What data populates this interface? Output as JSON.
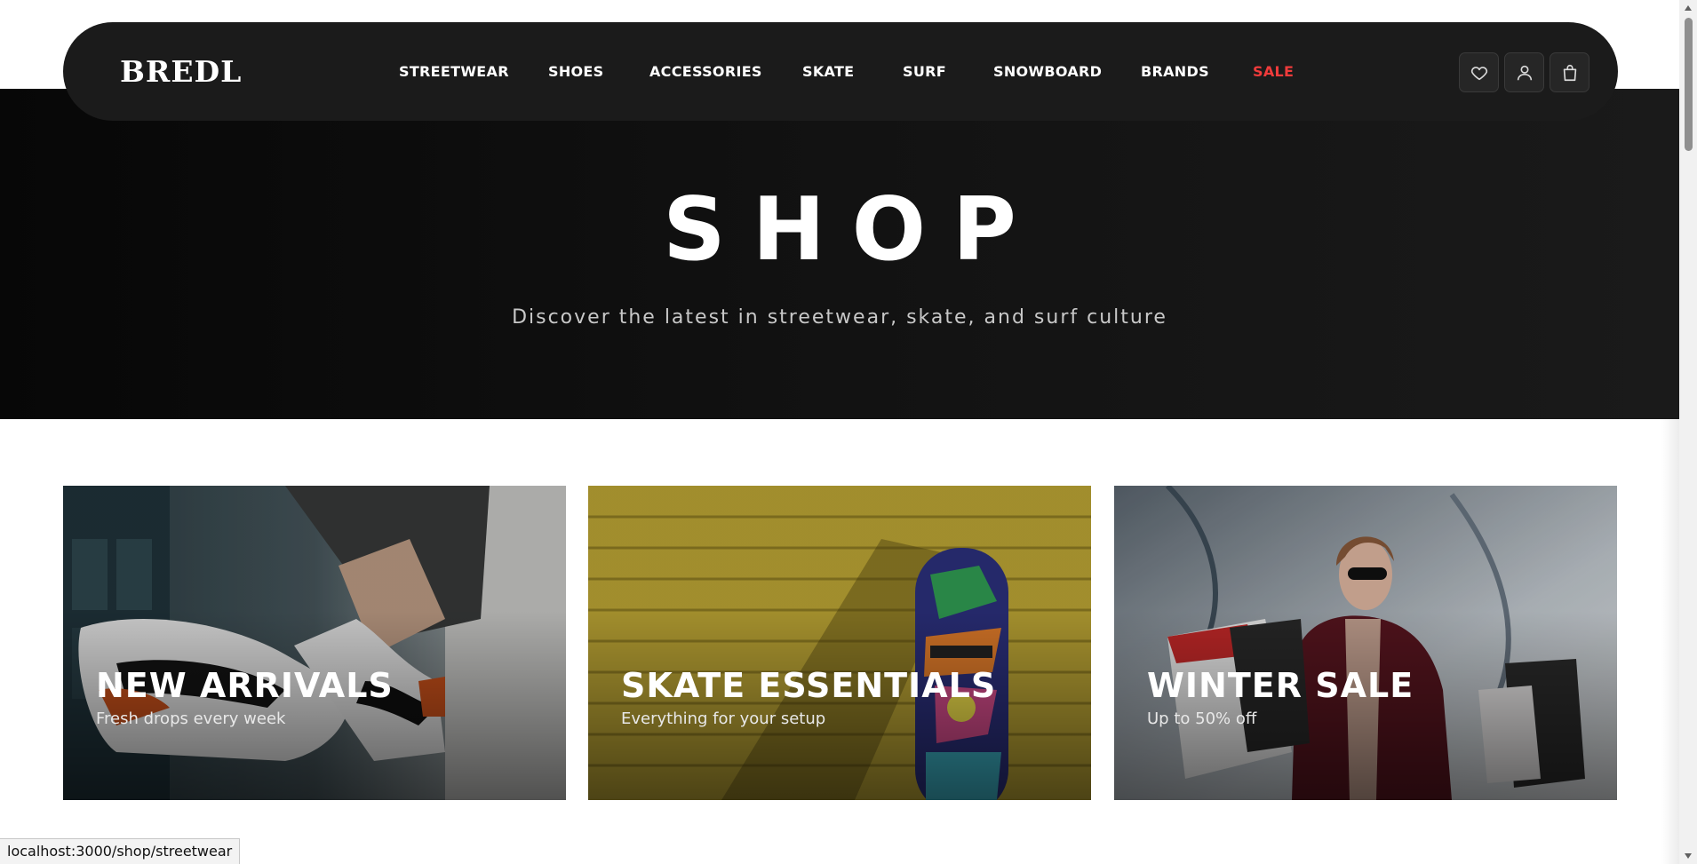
{
  "brand": {
    "logo": "BREDL"
  },
  "nav": {
    "items": [
      {
        "label": "STREETWEAR"
      },
      {
        "label": "SHOES"
      },
      {
        "label": "ACCESSORIES"
      },
      {
        "label": "SKATE"
      },
      {
        "label": "SURF"
      },
      {
        "label": "SNOWBOARD"
      },
      {
        "label": "BRANDS"
      },
      {
        "label": "SALE"
      }
    ],
    "sale_color": "#ef3b3b",
    "icons": [
      "heart-icon",
      "user-icon",
      "shopping-bag-icon"
    ]
  },
  "hero": {
    "title": "SHOP",
    "subtitle": "Discover the latest in streetwear, skate, and surf culture"
  },
  "cards": [
    {
      "title": "NEW ARRIVALS",
      "subtitle": "Fresh drops every week"
    },
    {
      "title": "SKATE ESSENTIALS",
      "subtitle": "Everything for your setup"
    },
    {
      "title": "WINTER SALE",
      "subtitle": "Up to 50% off"
    }
  ],
  "status_bar": {
    "url": "localhost:3000/shop/streetwear"
  },
  "colors": {
    "nav_bg": "#1b1b1b",
    "hero_bg": "#0b0b0b",
    "accent_sale": "#ef3b3b"
  }
}
